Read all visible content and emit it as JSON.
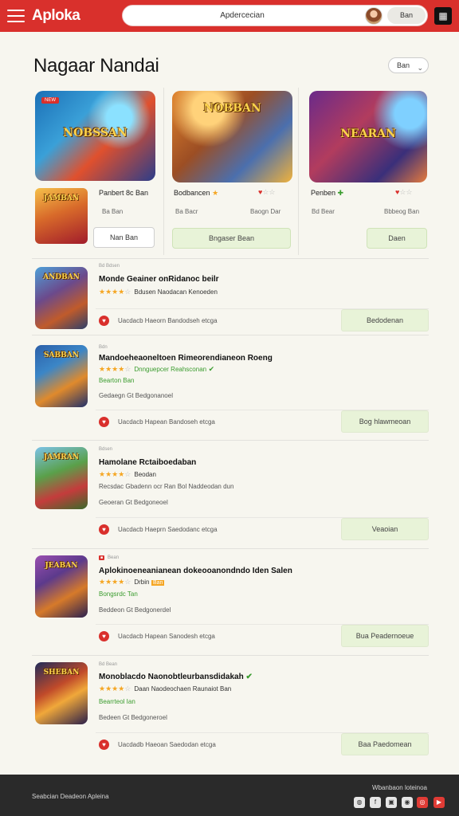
{
  "header": {
    "brand": "Aploka",
    "search_text": "Apdercecian",
    "search_count": "5",
    "search_button": "Ban"
  },
  "page": {
    "title": "Nagaar Nandai",
    "sort_label": "Ban"
  },
  "featured": [
    {
      "banner_logo": "NOBSSAN",
      "ribbon": "NEW",
      "thumb_logo": "JAMBAN",
      "title": "Panbert 8c Ban",
      "meta": "Ba Ban",
      "button": "Nan Ban"
    },
    {
      "banner_logo": "NOBBAN",
      "title": "Bodbancen",
      "meta_left": "Ba Bacr",
      "meta_right": "Baogn Dar",
      "button": "Bngaser Bean"
    },
    {
      "banner_logo": "NEARAN",
      "title": "Penben",
      "meta_left": "Bd Bear",
      "meta_right": "Bbbeog Ban",
      "button": "Daen"
    }
  ],
  "list": [
    {
      "tag": "Bd Bdsen",
      "thumb_logo": "ANDBAN",
      "title": "Monde Geainer onRidanoc beilr",
      "rating_text": "Bdusen Naodacan Kenoeden",
      "footer_text": "Uacdacb Haeorn Bandodseh etcga",
      "button": "Bedodenan"
    },
    {
      "tag": "Bdn",
      "thumb_logo": "SABBAN",
      "title": "Mandoeheaoneltoen Rimeorendianeon Roeng",
      "rating_text": "Dnnguepcer Reahsconan",
      "green_text": "Bearton Ban",
      "meta": "Gedaegn Gt Bedgonanoel",
      "footer_text": "Uacdacb Hapean Bandoseh etcga",
      "button": "Bog hlawmeoan"
    },
    {
      "tag": "Bdsen",
      "thumb_logo": "JAMRAN",
      "title": "Hamolane Rctaiboedaban",
      "rating_text": "Beodan",
      "desc": "Recsdac Gbadenn ocr Ran Bol Naddeodan dun",
      "meta": "Geoeran Gt Bedgoneoel",
      "footer_text": "Uacdacb Haeprn Saedodanc etcga",
      "button": "Veaoian"
    },
    {
      "tag": "Bean",
      "thumb_logo": "JEABAN",
      "title": "Aplokinoeneanianean dokeooanondndo Iden Salen",
      "rating_text": "Drbin",
      "green_text": "Bongsrdc Tan",
      "meta": "Beddeon Gt Bedgonerdel",
      "footer_text": "Uacdacb Hapean Sanodesh etcga",
      "button": "Bua Peadernoeue"
    },
    {
      "tag": "Bd Bean",
      "thumb_logo": "SHEBAN",
      "title": "Monoblacdo Naonobtleurbansdidakah",
      "rating_text": "Daan Naodeochaen Raunaiot Ban",
      "green_text": "Bearrteol Ian",
      "meta": "Bedeen Gt Bedgoneroel",
      "footer_text": "Uacdadb Haeoan Saedodan etcga",
      "button": "Baa Paedomean"
    }
  ],
  "footer": {
    "left_text": "Seabcian Deadeon Apleina",
    "right_text": "Wbanbaon loteinoa"
  },
  "colors": {
    "brand_red": "#d9302c",
    "accent_green": "#e8f3d8",
    "star": "#f5a623"
  }
}
